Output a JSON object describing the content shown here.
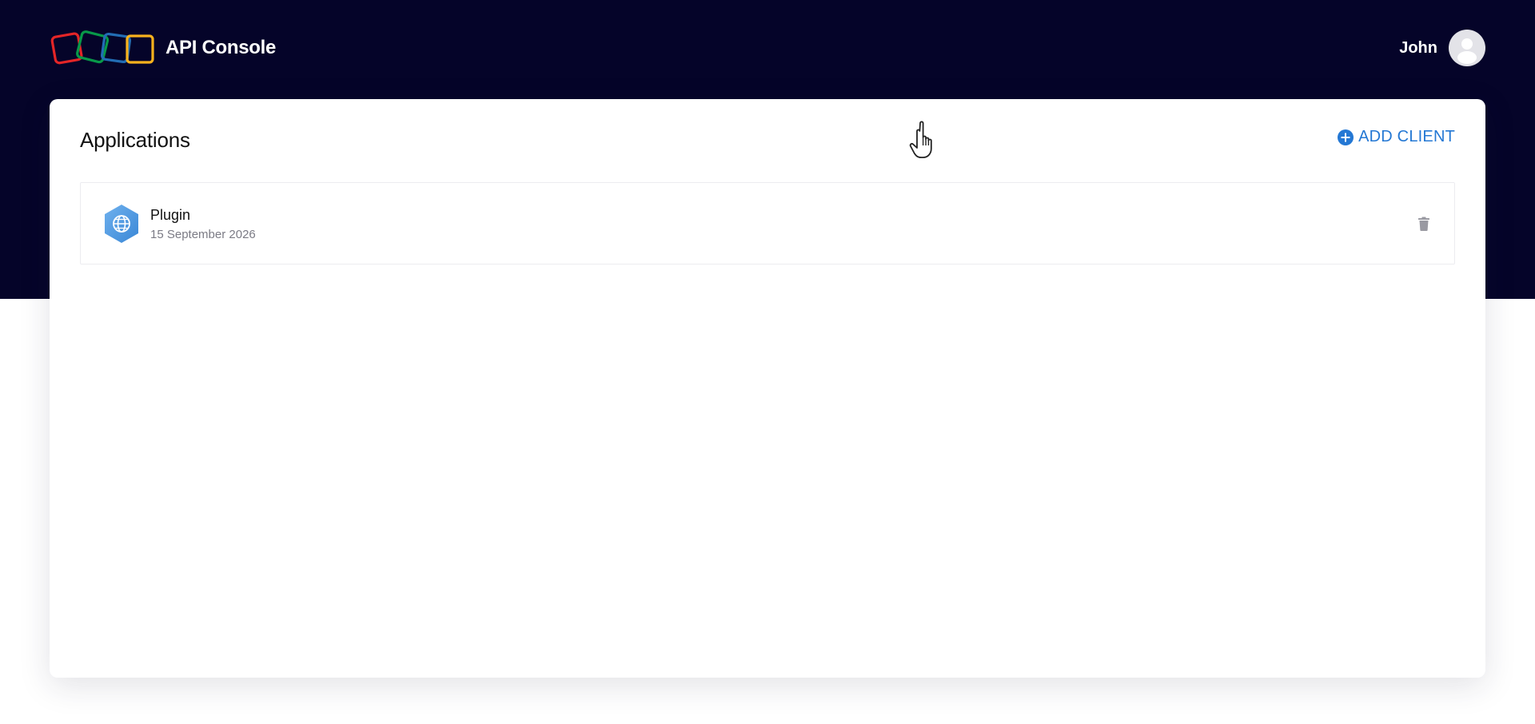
{
  "header": {
    "app_title": "API Console",
    "logo_icon": "zoho-logo-icon",
    "user_name": "John",
    "avatar_icon": "user-avatar-icon"
  },
  "card": {
    "title": "Applications",
    "add_client_label": "ADD CLIENT",
    "add_client_icon": "plus-circle-icon"
  },
  "applications": [
    {
      "name": "Plugin",
      "date": "15 September 2026",
      "icon": "globe-icon",
      "action_icon": "trash-icon"
    }
  ],
  "colors": {
    "header_background": "#050429",
    "accent": "#2478d4",
    "logo_red": "#e42527",
    "logo_green": "#089949",
    "logo_blue": "#226db4",
    "logo_yellow": "#f9b21d"
  }
}
